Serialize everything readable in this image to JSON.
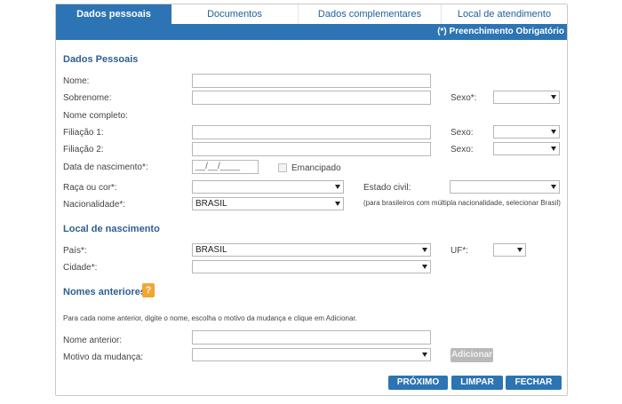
{
  "tabs": [
    {
      "label": "Dados pessoais",
      "active": true
    },
    {
      "label": "Documentos",
      "active": false
    },
    {
      "label": "Dados complementares",
      "active": false
    },
    {
      "label": "Local de atendimento",
      "active": false
    }
  ],
  "required_note": "(*) Preenchimento Obrigatório",
  "dados_pessoais": {
    "title": "Dados Pessoais",
    "nome_label": "Nome:",
    "sobrenome_label": "Sobrenome:",
    "sexo_label": "Sexo*:",
    "nome_completo_label": "Nome completo:",
    "filiacao1_label": "Filiação 1:",
    "filiacao2_label": "Filiação 2:",
    "sexo_f1_label": "Sexo:",
    "sexo_f2_label": "Sexo:",
    "nascimento_label": "Data de nascimento*:",
    "nascimento_value": "__/__/____",
    "emancipado_label": "Emancipado",
    "raca_label": "Raça ou cor*:",
    "estado_civil_label": "Estado civil:",
    "nacionalidade_label": "Nacionalidade*:",
    "nacionalidade_value": "BRASIL",
    "nacionalidade_hint": "(para brasileiros com múltipla nacionalidade, selecionar Brasil)"
  },
  "local_nascimento": {
    "title": "Local de nascimento",
    "pais_label": "País*:",
    "pais_value": "BRASIL",
    "uf_label": "UF*:",
    "cidade_label": "Cidade*:"
  },
  "nomes_anteriores": {
    "title": "Nomes anteriores",
    "help_symbol": "?",
    "instructions": "Para cada nome anterior, digite o nome, escolha o motivo da mudança e clique em Adicionar.",
    "nome_anterior_label": "Nome anterior:",
    "motivo_label": "Motivo da mudança:",
    "adicionar_label": "Adicionar"
  },
  "actions": {
    "proximo": "PRÓXIMO",
    "limpar": "LIMPAR",
    "fechar": "FECHAR"
  },
  "colors": {
    "accent": "#2c74b3",
    "section_title": "#2d5f92",
    "help": "#f3a531",
    "disabled_button": "#b9b9b9"
  }
}
